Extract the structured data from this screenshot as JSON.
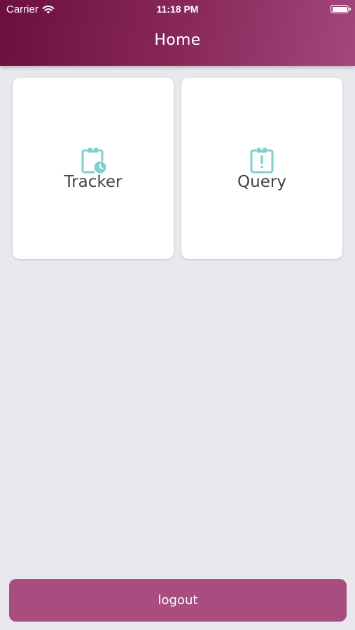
{
  "status_bar": {
    "carrier": "Carrier",
    "time": "11:18 PM",
    "wifi_icon": "wifi-icon",
    "battery_icon": "battery-icon",
    "battery_level": 1.0
  },
  "header": {
    "title": "Home"
  },
  "tiles": [
    {
      "label": "Tracker",
      "icon": "clipboard-clock-icon"
    },
    {
      "label": "Query",
      "icon": "clipboard-alert-icon"
    }
  ],
  "footer": {
    "logout_label": "logout"
  },
  "colors": {
    "header_gradient_start": "#6b0f3f",
    "header_gradient_end": "#a3477c",
    "icon_teal": "#7fd0cc",
    "logout_button": "#a84d80",
    "background": "#e9e8ee"
  }
}
